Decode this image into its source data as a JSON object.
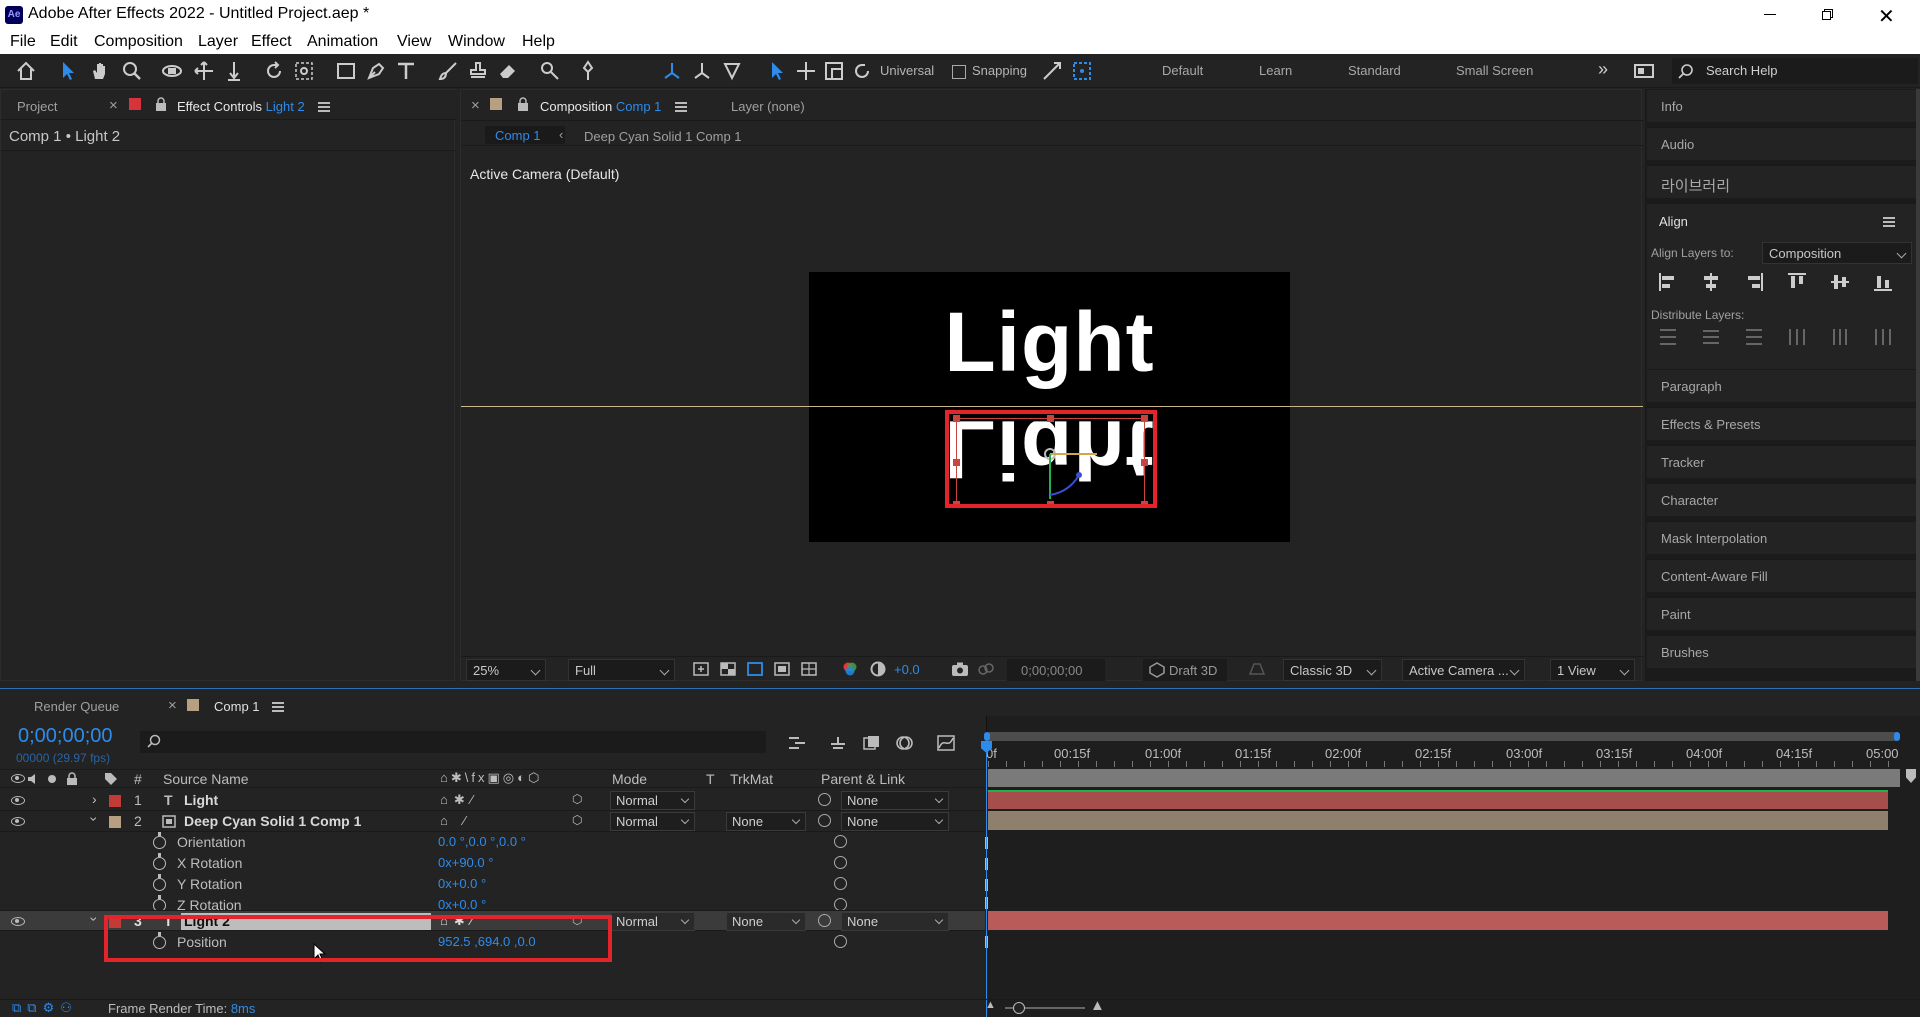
{
  "window": {
    "title": "Adobe After Effects 2022 - Untitled Project.aep *",
    "app_badge": "Ae"
  },
  "menu": [
    "File",
    "Edit",
    "Composition",
    "Layer",
    "Effect",
    "Animation",
    "View",
    "Window",
    "Help"
  ],
  "toolbar": {
    "axis_mode": "Universal",
    "snapping": "Snapping",
    "workspaces": [
      "Default",
      "Learn",
      "Standard",
      "Small Screen"
    ],
    "search_placeholder": "Search Help"
  },
  "left_panel": {
    "tab_project": "Project",
    "tab_effect_prefix": "Effect Controls",
    "tab_effect_layer": "Light 2",
    "breadcrumb": "Comp 1 • Light 2"
  },
  "comp_panel": {
    "tab_prefix": "Composition",
    "tab_comp": "Comp 1",
    "layer_tab": "Layer (none)",
    "subtab_active": "Comp 1",
    "subtab_other": "Deep Cyan Solid 1 Comp 1",
    "camera_label": "Active Camera (Default)",
    "canvas_text_top": "Light",
    "canvas_text_bottom": "Light",
    "footer": {
      "zoom": "25%",
      "resolution": "Full",
      "exposure": "+0.0",
      "timecode": "0;00;00;00",
      "draft": "Draft 3D",
      "renderer": "Classic 3D",
      "camera": "Active Camera ...",
      "views": "1 View"
    }
  },
  "right_panel": {
    "items_top": [
      "Info",
      "Audio",
      "라이브러리"
    ],
    "align": {
      "title": "Align",
      "align_to_label": "Align Layers to:",
      "align_to_value": "Composition",
      "distribute_label": "Distribute Layers:"
    },
    "items_bottom": [
      "Paragraph",
      "Effects & Presets",
      "Tracker",
      "Character",
      "Mask Interpolation",
      "Content-Aware Fill",
      "Paint",
      "Brushes"
    ]
  },
  "timeline": {
    "tab_render": "Render Queue",
    "tab_comp": "Comp 1",
    "timecode": "0;00;00;00",
    "fps": "00000 (29.97 fps)",
    "columns": {
      "hash": "#",
      "source": "Source Name",
      "mode": "Mode",
      "t": "T",
      "trkmat": "TrkMat",
      "parent": "Parent & Link"
    },
    "layers": [
      {
        "num": "1",
        "name": "Light",
        "mode": "Normal",
        "trkmat": "",
        "parent": "None",
        "color": "#c23b37"
      },
      {
        "num": "2",
        "name": "Deep Cyan Solid 1 Comp 1",
        "mode": "Normal",
        "trkmat": "None",
        "parent": "None",
        "color": "#b79f82"
      },
      {
        "num": "3",
        "name": "Light 2",
        "mode": "Normal",
        "trkmat": "None",
        "parent": "None",
        "color": "#c23b37"
      }
    ],
    "properties_layer2": [
      {
        "name": "Orientation",
        "value": "0.0 °,0.0 °,0.0 °"
      },
      {
        "name": "X Rotation",
        "value": "0x+90.0 °"
      },
      {
        "name": "Y Rotation",
        "value": "0x+0.0 °"
      },
      {
        "name": "Z Rotation",
        "value": "0x+0.0 °"
      }
    ],
    "properties_layer3": [
      {
        "name": "Position",
        "value": "952.5 ,694.0 ,0.0"
      }
    ],
    "ruler": [
      "0f",
      "00:15f",
      "01:00f",
      "01:15f",
      "02:00f",
      "02:15f",
      "03:00f",
      "03:15f",
      "04:00f",
      "04:15f",
      "05:00"
    ],
    "footer": {
      "label": "Frame Render Time:",
      "value": "8ms"
    }
  },
  "colors": {
    "accent": "#2d8ceb",
    "highlight": "#e3242b",
    "bar_red": "#a54e4b",
    "bar_tan": "#8e806d",
    "bar_green": "#22b14c"
  }
}
